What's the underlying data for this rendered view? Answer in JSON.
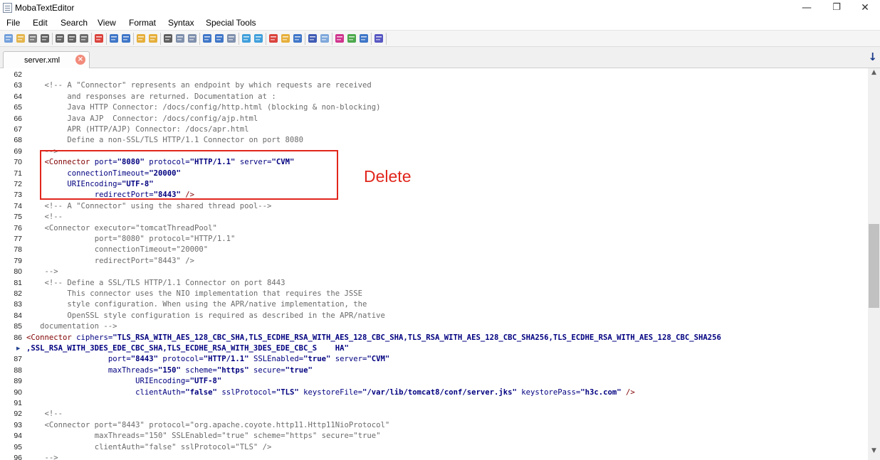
{
  "window": {
    "title": "MobaTextEditor",
    "minimize": "—",
    "restore": "❐",
    "close": "✕"
  },
  "menu": [
    "File",
    "Edit",
    "Search",
    "View",
    "Format",
    "Syntax",
    "Special Tools"
  ],
  "toolbar": [
    {
      "name": "new-file-icon",
      "color": "#5b8fd6"
    },
    {
      "name": "open-folder-icon",
      "color": "#e0a92e"
    },
    {
      "name": "history-icon",
      "color": "#666666"
    },
    {
      "name": "save-icon",
      "color": "#4a4a4a"
    },
    {
      "name": "save-as-icon",
      "color": "#4a4a4a"
    },
    {
      "name": "save-all-icon",
      "color": "#4a4a4a"
    },
    {
      "name": "print-icon",
      "color": "#555555"
    },
    {
      "name": "close-file-icon",
      "color": "#d6231c"
    },
    {
      "name": "indent-icon",
      "color": "#1f5fbf"
    },
    {
      "name": "outdent-icon",
      "color": "#1f5fbf"
    },
    {
      "name": "bookmark-icon",
      "color": "#e3a21a"
    },
    {
      "name": "bookmark-next-icon",
      "color": "#e3a21a"
    },
    {
      "name": "cut-icon",
      "color": "#444444"
    },
    {
      "name": "copy-icon",
      "color": "#6a7ea0"
    },
    {
      "name": "paste-icon",
      "color": "#6a7ea0"
    },
    {
      "name": "find-icon",
      "color": "#1f5fbf"
    },
    {
      "name": "find-next-icon",
      "color": "#1f5fbf"
    },
    {
      "name": "replace-icon",
      "color": "#6a7ea0"
    },
    {
      "name": "compare-icon",
      "color": "#1f8fd6"
    },
    {
      "name": "merge-icon",
      "color": "#1f8fd6"
    },
    {
      "name": "color-icon",
      "color": "#d6231c"
    },
    {
      "name": "syntax-icon",
      "color": "#e3a21a"
    },
    {
      "name": "apple-icon",
      "color": "#1f5fbf"
    },
    {
      "name": "undo-icon",
      "color": "#1f3fa8"
    },
    {
      "name": "redo-icon",
      "color": "#6a9ad6"
    },
    {
      "name": "paragraph-icon",
      "color": "#c8127a"
    },
    {
      "name": "pen-icon",
      "color": "#2e9b2e"
    },
    {
      "name": "settings-icon",
      "color": "#1f5fbf"
    },
    {
      "name": "exit-icon",
      "color": "#3a3ab8"
    }
  ],
  "tab": {
    "label": "server.xml",
    "close": "×"
  },
  "scroll": {
    "down_button": "↓",
    "up_arrow": "▲",
    "down_arrow": "▼"
  },
  "annotation": {
    "label": "Delete"
  },
  "colors": {
    "annotation": "#e1261c",
    "comment": "#6b6b6b",
    "tag": "#800000",
    "attr": "#000080"
  },
  "lines": [
    {
      "n": "62",
      "indent": 0,
      "spans": []
    },
    {
      "n": "63",
      "indent": 4,
      "spans": [
        {
          "t": "<!-- A \"Connector\" represents an endpoint by which requests are received",
          "c": "cmt"
        }
      ]
    },
    {
      "n": "64",
      "indent": 9,
      "spans": [
        {
          "t": "and responses are returned. Documentation at :",
          "c": "cmt"
        }
      ]
    },
    {
      "n": "65",
      "indent": 9,
      "spans": [
        {
          "t": "Java HTTP Connector: /docs/config/http.html (blocking & non-blocking)",
          "c": "cmt"
        }
      ]
    },
    {
      "n": "66",
      "indent": 9,
      "spans": [
        {
          "t": "Java AJP  Connector: /docs/config/ajp.html",
          "c": "cmt"
        }
      ]
    },
    {
      "n": "67",
      "indent": 9,
      "spans": [
        {
          "t": "APR (HTTP/AJP) Connector: /docs/apr.html",
          "c": "cmt"
        }
      ]
    },
    {
      "n": "68",
      "indent": 9,
      "spans": [
        {
          "t": "Define a non-SSL/TLS HTTP/1.1 Connector on port 8080",
          "c": "cmt"
        }
      ]
    },
    {
      "n": "69",
      "indent": 4,
      "spans": [
        {
          "t": "-->",
          "c": "cmt"
        }
      ]
    },
    {
      "n": "70",
      "indent": 4,
      "spans": [
        {
          "t": "<",
          "c": "tag"
        },
        {
          "t": "Connector",
          "c": "tag"
        },
        {
          "t": " port=",
          "c": "attr"
        },
        {
          "t": "\"8080\"",
          "c": "val"
        },
        {
          "t": " protocol=",
          "c": "attr"
        },
        {
          "t": "\"HTTP/1.1\"",
          "c": "val"
        },
        {
          "t": " server=",
          "c": "attr"
        },
        {
          "t": "\"CVM\"",
          "c": "val"
        }
      ]
    },
    {
      "n": "71",
      "indent": 9,
      "spans": [
        {
          "t": "connectionTimeout=",
          "c": "attr"
        },
        {
          "t": "\"20000\"",
          "c": "val"
        }
      ]
    },
    {
      "n": "72",
      "indent": 9,
      "spans": [
        {
          "t": "URIEncoding=",
          "c": "attr"
        },
        {
          "t": "\"UTF-8\"",
          "c": "val"
        }
      ]
    },
    {
      "n": "73",
      "indent": 15,
      "spans": [
        {
          "t": "redirectPort=",
          "c": "attr"
        },
        {
          "t": "\"8443\"",
          "c": "val"
        },
        {
          "t": " />",
          "c": "tag"
        }
      ]
    },
    {
      "n": "74",
      "indent": 4,
      "spans": [
        {
          "t": "<!-- A \"Connector\" using the shared thread pool-->",
          "c": "cmt"
        }
      ]
    },
    {
      "n": "75",
      "indent": 4,
      "spans": [
        {
          "t": "<!--",
          "c": "cmt"
        }
      ]
    },
    {
      "n": "76",
      "indent": 4,
      "spans": [
        {
          "t": "<Connector executor=\"tomcatThreadPool\"",
          "c": "cmt"
        }
      ]
    },
    {
      "n": "77",
      "indent": 15,
      "spans": [
        {
          "t": "port=\"8080\" protocol=\"HTTP/1.1\"",
          "c": "cmt"
        }
      ]
    },
    {
      "n": "78",
      "indent": 15,
      "spans": [
        {
          "t": "connectionTimeout=\"20000\"",
          "c": "cmt"
        }
      ]
    },
    {
      "n": "79",
      "indent": 15,
      "spans": [
        {
          "t": "redirectPort=\"8443\" />",
          "c": "cmt"
        }
      ]
    },
    {
      "n": "80",
      "indent": 4,
      "spans": [
        {
          "t": "-->",
          "c": "cmt"
        }
      ]
    },
    {
      "n": "81",
      "indent": 4,
      "spans": [
        {
          "t": "<!-- Define a SSL/TLS HTTP/1.1 Connector on port 8443",
          "c": "cmt"
        }
      ]
    },
    {
      "n": "82",
      "indent": 9,
      "spans": [
        {
          "t": "This connector uses the NIO implementation that requires the JSSE",
          "c": "cmt"
        }
      ]
    },
    {
      "n": "83",
      "indent": 9,
      "spans": [
        {
          "t": "style configuration. When using the APR/native implementation, the",
          "c": "cmt"
        }
      ]
    },
    {
      "n": "84",
      "indent": 9,
      "spans": [
        {
          "t": "OpenSSL style configuration is required as described in the APR/native",
          "c": "cmt"
        }
      ]
    },
    {
      "n": "85",
      "indent": 3,
      "spans": [
        {
          "t": "documentation -->",
          "c": "cmt"
        }
      ]
    },
    {
      "n": "86",
      "indent": 0,
      "spans": [
        {
          "t": "<",
          "c": "tag"
        },
        {
          "t": "Connector",
          "c": "tag"
        },
        {
          "t": " ciphers=",
          "c": "attr"
        },
        {
          "t": "\"TLS_RSA_WITH_AES_128_CBC_SHA,TLS_ECDHE_RSA_WITH_AES_128_CBC_SHA,TLS_RSA_WITH_AES_128_CBC_SHA256,TLS_ECDHE_RSA_WITH_AES_128_CBC_SHA256",
          "c": "val"
        }
      ]
    },
    {
      "n": "",
      "indent": 0,
      "wrap": true,
      "spans": [
        {
          "t": ",SSL_RSA_WITH_3DES_EDE_CBC_SHA,TLS_ECDHE_RSA_WITH_3DES_EDE_CBC_S    HA\"",
          "c": "val"
        }
      ]
    },
    {
      "n": "87",
      "indent": 18,
      "spans": [
        {
          "t": "port=",
          "c": "attr"
        },
        {
          "t": "\"8443\"",
          "c": "val"
        },
        {
          "t": " protocol=",
          "c": "attr"
        },
        {
          "t": "\"HTTP/1.1\"",
          "c": "val"
        },
        {
          "t": " SSLEnabled=",
          "c": "attr"
        },
        {
          "t": "\"true\"",
          "c": "val"
        },
        {
          "t": " server=",
          "c": "attr"
        },
        {
          "t": "\"CVM\"",
          "c": "val"
        }
      ]
    },
    {
      "n": "88",
      "indent": 18,
      "spans": [
        {
          "t": "maxThreads=",
          "c": "attr"
        },
        {
          "t": "\"150\"",
          "c": "val"
        },
        {
          "t": " scheme=",
          "c": "attr"
        },
        {
          "t": "\"https\"",
          "c": "val"
        },
        {
          "t": " secure=",
          "c": "attr"
        },
        {
          "t": "\"true\"",
          "c": "val"
        }
      ]
    },
    {
      "n": "89",
      "indent": 24,
      "spans": [
        {
          "t": "URIEncoding=",
          "c": "attr"
        },
        {
          "t": "\"UTF-8\"",
          "c": "val"
        }
      ]
    },
    {
      "n": "90",
      "indent": 24,
      "spans": [
        {
          "t": "clientAuth=",
          "c": "attr"
        },
        {
          "t": "\"false\"",
          "c": "val"
        },
        {
          "t": " sslProtocol=",
          "c": "attr"
        },
        {
          "t": "\"TLS\"",
          "c": "val"
        },
        {
          "t": " keystoreFile=",
          "c": "attr"
        },
        {
          "t": "\"/var/lib/tomcat8/conf/server.jks\"",
          "c": "val"
        },
        {
          "t": " keystorePass=",
          "c": "attr"
        },
        {
          "t": "\"h3c.com\"",
          "c": "val"
        },
        {
          "t": " />",
          "c": "tag"
        }
      ]
    },
    {
      "n": "91",
      "indent": 0,
      "spans": []
    },
    {
      "n": "92",
      "indent": 4,
      "spans": [
        {
          "t": "<!--",
          "c": "cmt"
        }
      ]
    },
    {
      "n": "93",
      "indent": 4,
      "spans": [
        {
          "t": "<Connector port=\"8443\" protocol=\"org.apache.coyote.http11.Http11NioProtocol\"",
          "c": "cmt"
        }
      ]
    },
    {
      "n": "94",
      "indent": 15,
      "spans": [
        {
          "t": "maxThreads=\"150\" SSLEnabled=\"true\" scheme=\"https\" secure=\"true\"",
          "c": "cmt"
        }
      ]
    },
    {
      "n": "95",
      "indent": 15,
      "spans": [
        {
          "t": "clientAuth=\"false\" sslProtocol=\"TLS\" />",
          "c": "cmt"
        }
      ]
    },
    {
      "n": "96",
      "indent": 4,
      "spans": [
        {
          "t": "-->",
          "c": "cmt"
        }
      ]
    }
  ]
}
